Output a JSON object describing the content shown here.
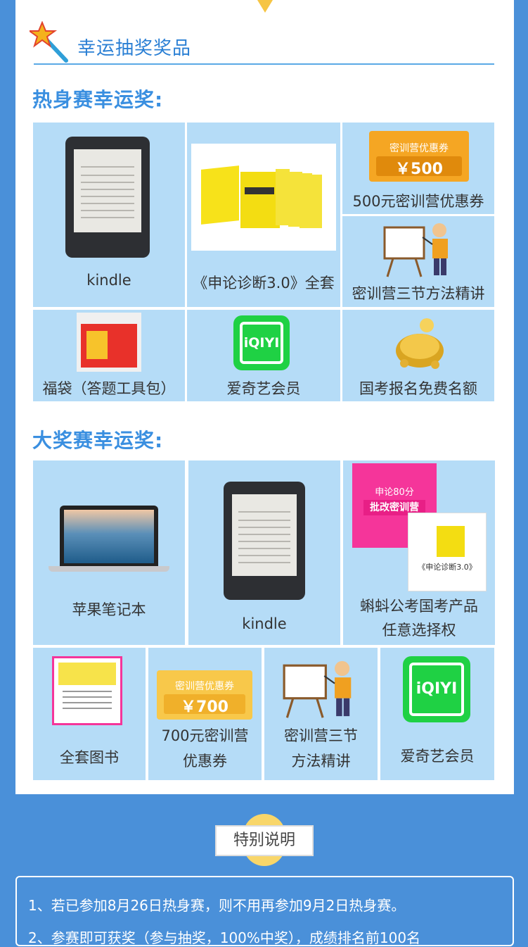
{
  "header": {
    "title": "幸运抽奖奖品"
  },
  "warmup": {
    "heading": "热身赛幸运奖:",
    "prizes": [
      {
        "label": "kindle"
      },
      {
        "label": "《申论诊断3.0》全套"
      },
      {
        "label": "500元密训营优惠券",
        "coupon_title": "密训营优惠券",
        "coupon_value": "￥500"
      },
      {
        "label": "密训营三节方法精讲"
      },
      {
        "label": "福袋（答题工具包）"
      },
      {
        "label": "爱奇艺会员",
        "logo": "iQIYI"
      },
      {
        "label": "国考报名免费名额"
      }
    ]
  },
  "grand": {
    "heading": "大奖赛幸运奖:",
    "prizes": [
      {
        "label": "苹果笔记本"
      },
      {
        "label": "kindle"
      },
      {
        "label_line1": "蝌蚪公考国考产品",
        "label_line2": "任意选择权",
        "book_banner": "申论80分",
        "book_title": "批改密训营",
        "book_caption": "《申论诊断3.0》"
      },
      {
        "label": "全套图书"
      },
      {
        "label_line1": "700元密训营",
        "label_line2": "优惠券",
        "coupon_title": "密训营优惠券",
        "coupon_value": "￥700"
      },
      {
        "label_line1": "密训营三节",
        "label_line2": "方法精讲"
      },
      {
        "label": "爱奇艺会员",
        "logo": "iQIYI"
      }
    ]
  },
  "special": {
    "title": "特别说明",
    "notes": [
      "1、若已参加8月26日热身赛，则不用再参加9月2日热身赛。",
      "2、参赛即可获奖（参与抽奖，100%中奖），成绩排名前100名"
    ]
  },
  "colors": {
    "accent": "#3a8fe0",
    "cell": "#b5dcf7",
    "background": "#4a90d9",
    "coupon": "#f5a623",
    "iqiyi": "#1fd144"
  }
}
